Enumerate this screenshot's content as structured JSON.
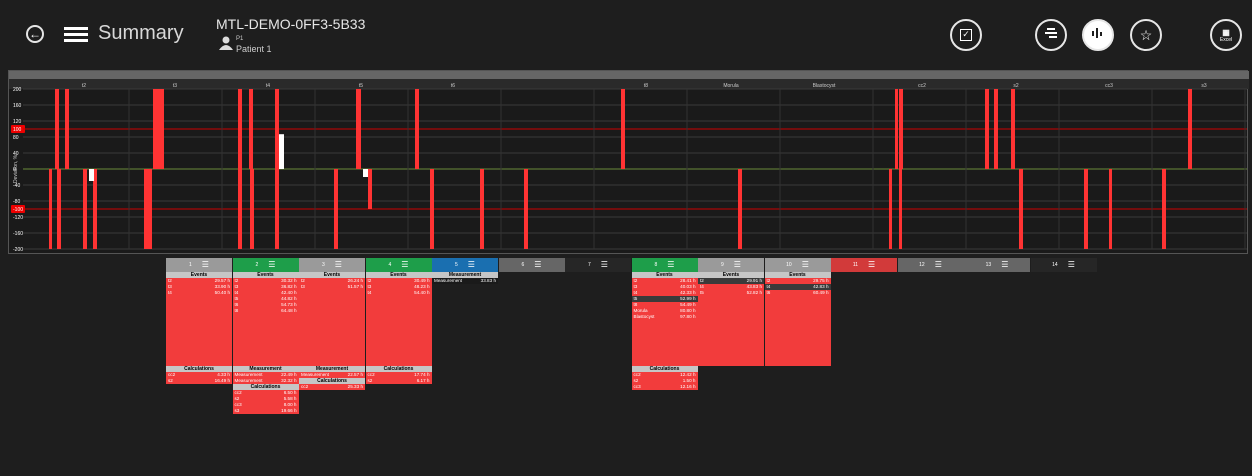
{
  "header": {
    "title": "Summary",
    "embryo_id": "MTL-DEMO-0FF3-5B33",
    "slide_id": "P1",
    "patient": "Patient 1",
    "excel_label": "Excel"
  },
  "chart_data": {
    "type": "bar",
    "ylabel": "Deviation, %",
    "yticks": [
      200,
      160,
      120,
      100,
      80,
      40,
      0,
      -40,
      -80,
      -100,
      -120,
      -160,
      -200
    ],
    "ylim": [
      -200,
      200
    ],
    "threshold_lines": [
      100,
      -100
    ],
    "highlighted_ticks": [
      100,
      -100
    ],
    "columns": [
      "t2",
      "t3",
      "t4",
      "t5",
      "t6",
      "t8",
      "Morula",
      "Blastocyst",
      "cc2",
      "s2",
      "cc3",
      "s3"
    ],
    "grid": true
  },
  "cards": [
    {
      "num": "1",
      "color": "#9a9a9a",
      "events": [
        [
          "t2",
          "29.57 h"
        ],
        [
          "t3",
          "33.90 h"
        ],
        [
          "t4",
          "50.40 h"
        ]
      ],
      "calc": [
        [
          "cc2",
          "4.33 h"
        ],
        [
          "s2",
          "16.49 h"
        ]
      ]
    },
    {
      "num": "2",
      "color": "#1e9e4a",
      "events": [
        [
          "t2",
          "30.32 h"
        ],
        [
          "t3",
          "36.82 h"
        ],
        [
          "t4",
          "42.40 h"
        ],
        [
          "t5",
          "44.82 h"
        ],
        [
          "t6",
          "54.73 h"
        ],
        [
          "t8",
          "64.48 h"
        ]
      ],
      "meas": [
        [
          "Measurement",
          "22.49 h"
        ],
        [
          "Measurement",
          "32.32 h"
        ]
      ],
      "calc": [
        [
          "cc2",
          "6.50 h"
        ],
        [
          "s2",
          "5.58 h"
        ],
        [
          "cc3",
          "8.00 h"
        ],
        [
          "s3",
          "19.66 h"
        ]
      ]
    },
    {
      "num": "3",
      "color": "#9a9a9a",
      "events": [
        [
          "t2",
          "26.24 h"
        ],
        [
          "t3",
          "51.57 h"
        ]
      ],
      "meas": [
        [
          "Measurement",
          "22.57 h"
        ]
      ],
      "calc": [
        [
          "cc2",
          "25.33 h"
        ]
      ]
    },
    {
      "num": "4",
      "color": "#1e9e4a",
      "events": [
        [
          "t2",
          "30.49 h"
        ],
        [
          "t3",
          "48.23 h"
        ],
        [
          "t4",
          "54.40 h"
        ]
      ],
      "calc": [
        [
          "cc2",
          "17.74 h"
        ],
        [
          "s2",
          "6.17 h"
        ]
      ]
    },
    {
      "num": "5",
      "color": "#1a6fb0",
      "meas_only": [
        [
          "Measurement",
          "33.83 h"
        ]
      ]
    },
    {
      "num": "6",
      "color": "#666"
    },
    {
      "num": "7",
      "color": "#262626"
    },
    {
      "num": "8",
      "color": "#1e9e4a",
      "events": [
        [
          "t2",
          "28.41 h"
        ],
        [
          "t3",
          "40.03 h"
        ],
        [
          "t4",
          "42.33 h"
        ],
        [
          "t5",
          "52.99 h"
        ],
        [
          "t8",
          "54.49 h"
        ],
        [
          "Morula",
          "80.80 h"
        ],
        [
          "Blastocyst",
          "97.80 h"
        ]
      ],
      "calc": [
        [
          "cc2",
          "12.42 h"
        ],
        [
          "s2",
          "1.50 h"
        ],
        [
          "cc3",
          "12.16 h"
        ]
      ]
    },
    {
      "num": "9",
      "color": "#9a9a9a",
      "events": [
        [
          "t2",
          "29.91 h"
        ],
        [
          "t4",
          "43.83 h"
        ],
        [
          "t5",
          "52.82 h"
        ]
      ]
    },
    {
      "num": "10",
      "color": "#9a9a9a",
      "events": [
        [
          "t2",
          "29.75 h"
        ],
        [
          "t4",
          "42.83 h"
        ],
        [
          "t6",
          "60.49 h"
        ]
      ]
    },
    {
      "num": "11",
      "color": "#d23a3a"
    },
    {
      "num": "12",
      "color": "#666"
    },
    {
      "num": "13",
      "color": "#666"
    },
    {
      "num": "14",
      "color": "#262626"
    }
  ],
  "labels": {
    "events": "Events",
    "calculations": "Calculations",
    "measurement": "Measurement"
  }
}
